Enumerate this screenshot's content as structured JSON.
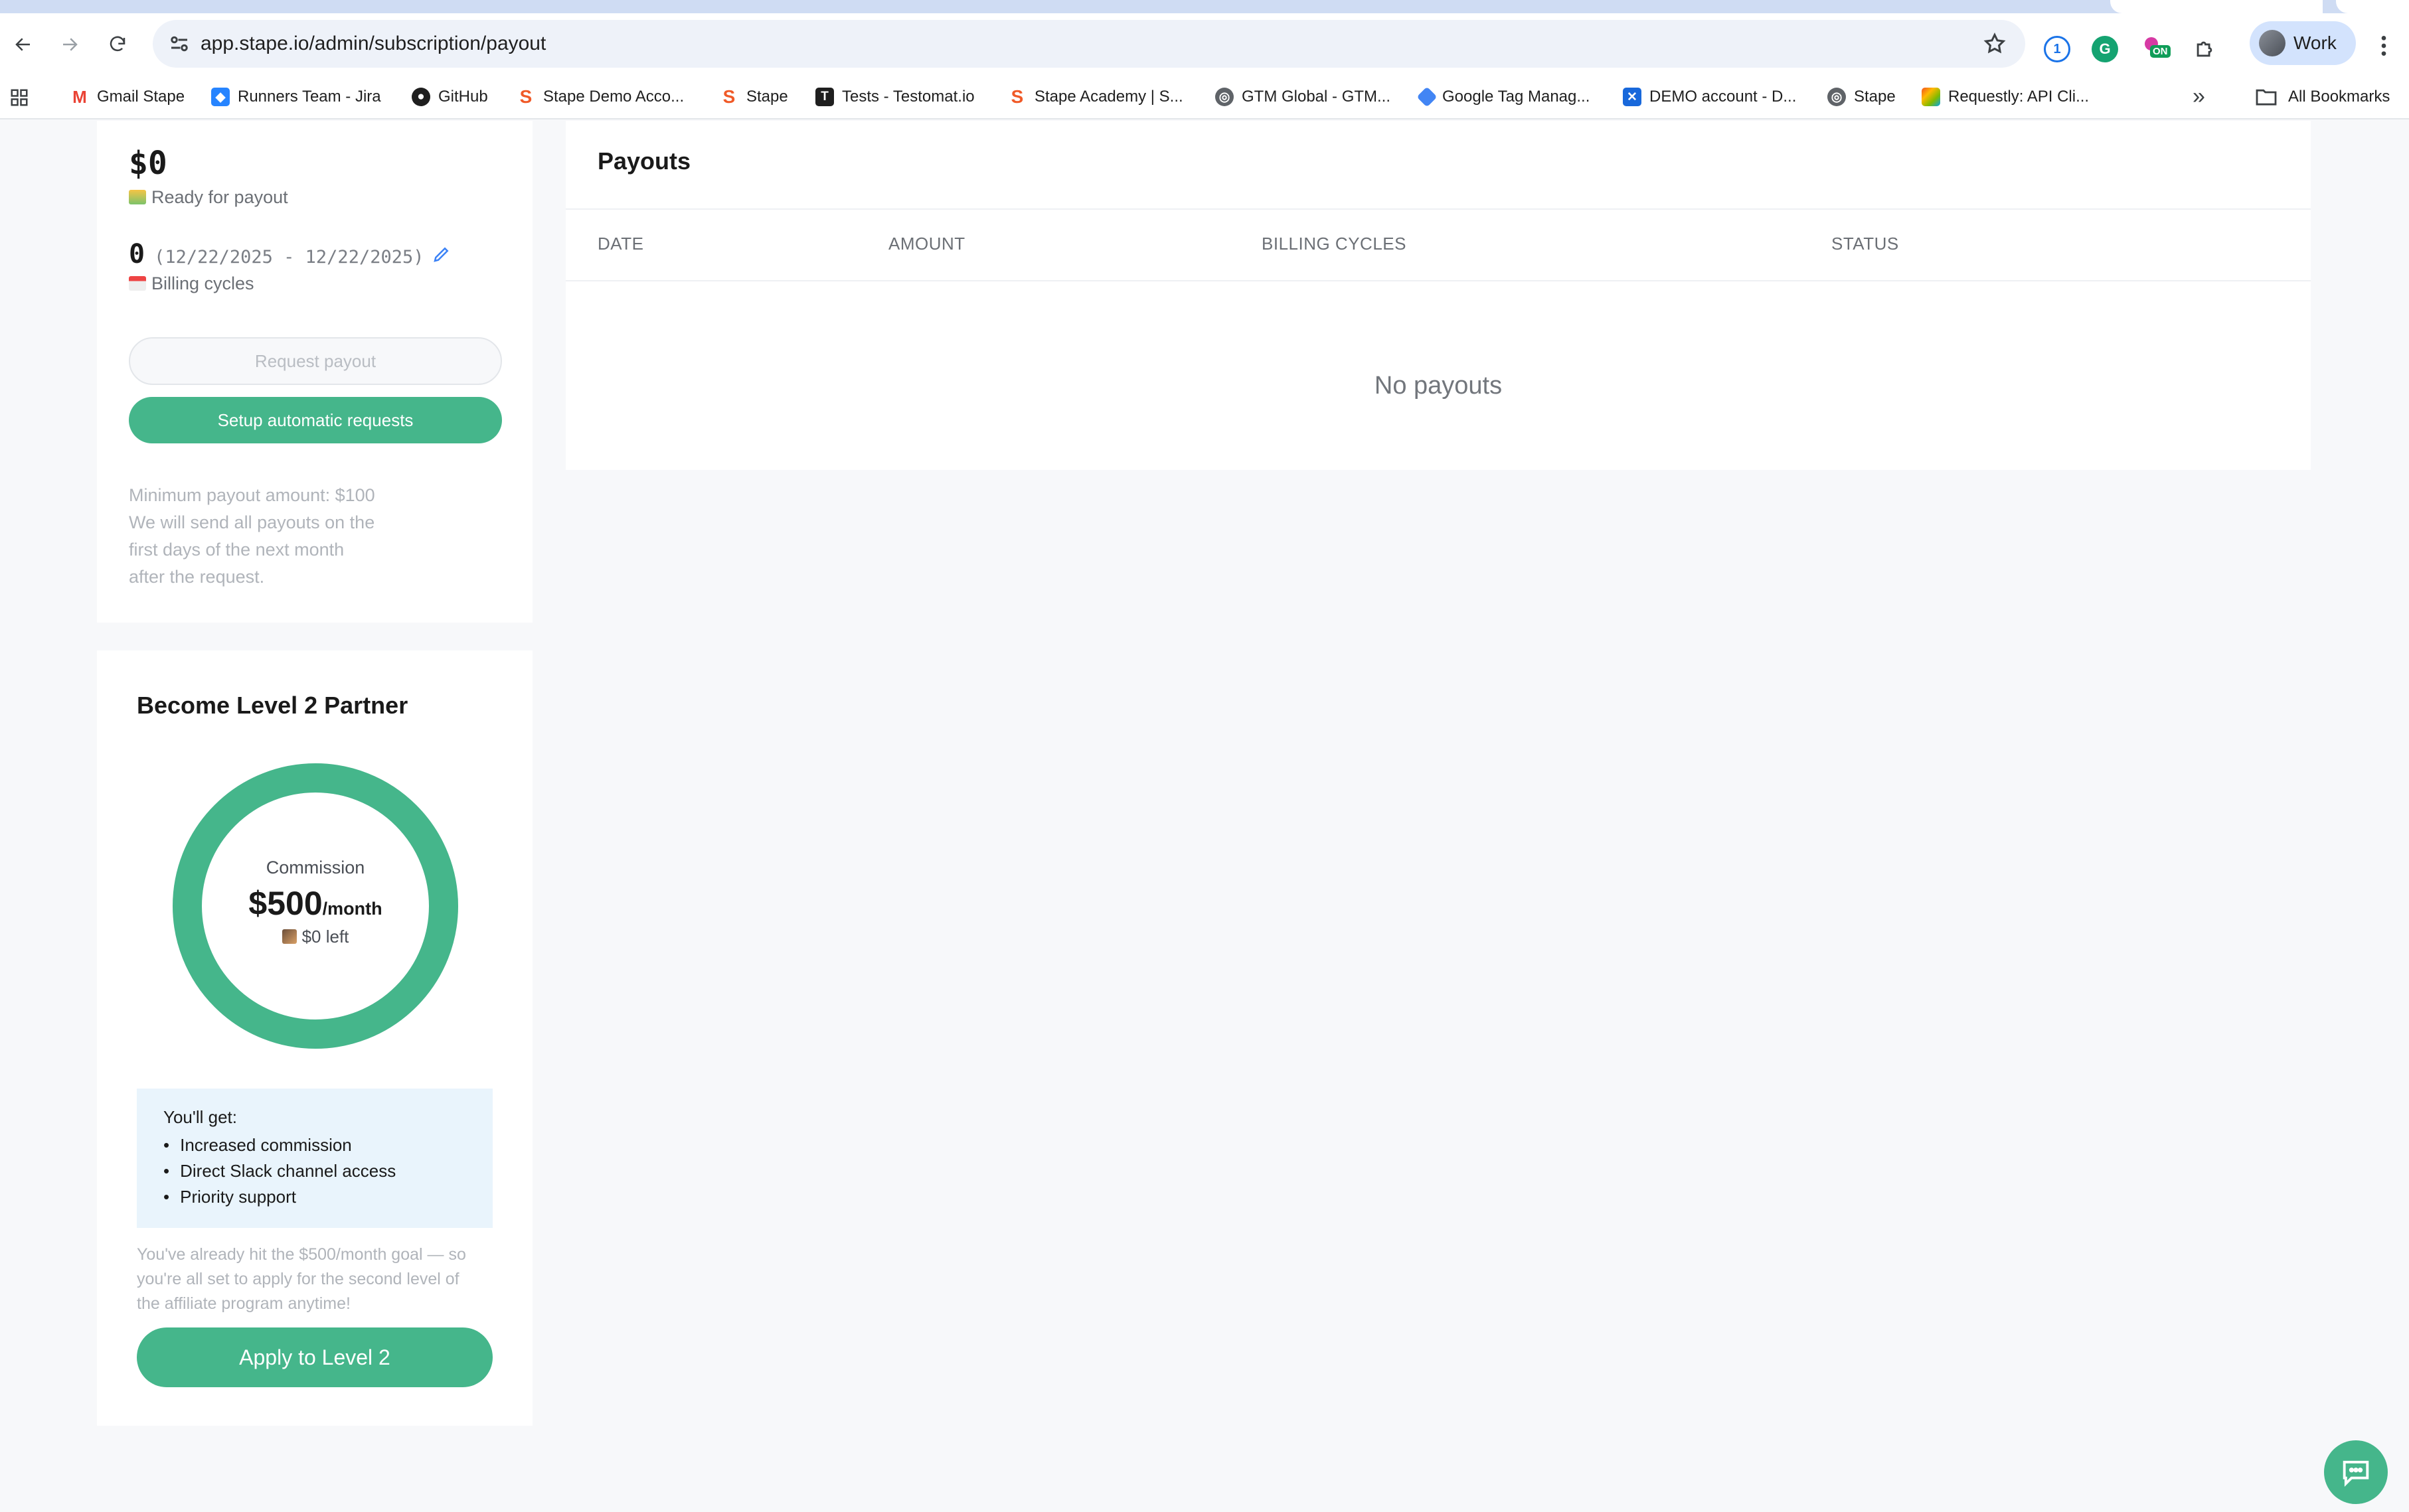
{
  "browser": {
    "url": "app.stape.io/admin/subscription/payout",
    "profile_label": "Work",
    "bookmarks": [
      {
        "label": "Gmail Stape",
        "icon": "gmail-icon"
      },
      {
        "label": "Runners Team - Jira",
        "icon": "jira-icon"
      },
      {
        "label": "GitHub",
        "icon": "github-icon"
      },
      {
        "label": "Stape Demo Acco...",
        "icon": "stape-icon"
      },
      {
        "label": "Stape",
        "icon": "stape-icon"
      },
      {
        "label": "Tests - Testomat.io",
        "icon": "testomat-icon"
      },
      {
        "label": "Stape Academy | S...",
        "icon": "stape-icon"
      },
      {
        "label": "GTM Global - GTM...",
        "icon": "globe-icon"
      },
      {
        "label": "Google Tag Manag...",
        "icon": "gtm-icon"
      },
      {
        "label": "DEMO account - D...",
        "icon": "confluence-icon"
      },
      {
        "label": "Stape",
        "icon": "globe-icon"
      },
      {
        "label": "Requestly: API Cli...",
        "icon": "requestly-icon"
      }
    ],
    "all_bookmarks_label": "All Bookmarks",
    "extension_badge": "ON"
  },
  "payout_summary": {
    "balance": "$0",
    "ready_label": "Ready for payout",
    "cycles_count": "0",
    "cycles_range": "(12/22/2025 - 12/22/2025)",
    "billing_label": "Billing cycles",
    "request_button": "Request payout",
    "auto_button": "Setup automatic requests",
    "note_lines": [
      "Minimum payout amount: $100",
      "We will send all payouts on the",
      "first days of the next month",
      "after the request."
    ]
  },
  "level": {
    "title": "Become Level 2 Partner",
    "commission_label": "Commission",
    "commission_amount": "$500",
    "commission_unit": "/month",
    "commission_left": "$0 left",
    "progress_fraction": 1.0,
    "benefits_title": "You'll get:",
    "benefits": [
      "Increased commission",
      "Direct Slack channel access",
      "Priority support"
    ],
    "note": "You've already hit the $500/month goal — so you're all set to apply for the second level of the affiliate program anytime!",
    "apply_button": "Apply to Level 2"
  },
  "payouts": {
    "title": "Payouts",
    "columns": [
      "DATE",
      "AMOUNT",
      "BILLING CYCLES",
      "STATUS"
    ],
    "empty_text": "No payouts"
  },
  "colors": {
    "accent": "#45b68b",
    "benefits_bg": "#e9f4fc",
    "edit_icon": "#3b82f6"
  }
}
